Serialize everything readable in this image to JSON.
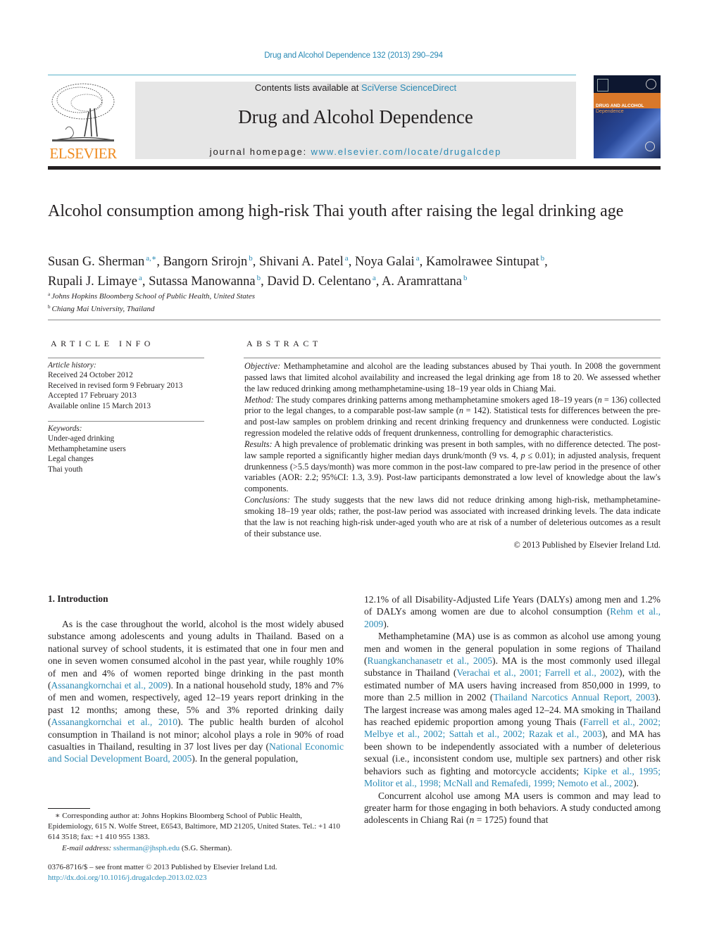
{
  "header": {
    "running_head": "Drug and Alcohol Dependence 132 (2013) 290–294",
    "contents_prefix": "Contents lists available at ",
    "contents_link": "SciVerse ScienceDirect",
    "journal_name": "Drug and Alcohol Dependence",
    "homepage_prefix": "journal homepage: ",
    "homepage_link": "www.elsevier.com/locate/drugalcdep",
    "publisher_logo_text": "ELSEVIER",
    "cover_title_line1": "DRUG AND ALCOHOL",
    "cover_title_line2": "Dependence"
  },
  "colors": {
    "link": "#2a8ab5",
    "elsevier_orange": "#ef8a1e",
    "banner_gray": "#e6e6e6",
    "cover_orange": "#d9782a",
    "cover_blue": "#2a4a9a"
  },
  "article": {
    "title": "Alcohol consumption among high-risk Thai youth after raising the legal drinking age",
    "authors": [
      {
        "name": "Susan G. Sherman",
        "aff": "a,∗",
        "sep": ", "
      },
      {
        "name": "Bangorn Srirojn",
        "aff": "b",
        "sep": ", "
      },
      {
        "name": "Shivani A. Patel",
        "aff": "a",
        "sep": ", "
      },
      {
        "name": "Noya Galai",
        "aff": "a",
        "sep": ", "
      },
      {
        "name": "Kamolrawee Sintupat",
        "aff": "b",
        "sep": ","
      },
      {
        "name": "Rupali J. Limaye",
        "aff": "a",
        "sep": ", "
      },
      {
        "name": "Sutassa Manowanna",
        "aff": "b",
        "sep": ", "
      },
      {
        "name": "David D. Celentano",
        "aff": "a",
        "sep": ", "
      },
      {
        "name": "A. Aramrattana",
        "aff": "b",
        "sep": ""
      }
    ],
    "affiliations": [
      {
        "label": "a",
        "text": "Johns Hopkins Bloomberg School of Public Health, United States"
      },
      {
        "label": "b",
        "text": "Chiang Mai University, Thailand"
      }
    ]
  },
  "article_info": {
    "heading": "ARTICLE INFO",
    "history_label": "Article history:",
    "history": [
      "Received 24 October 2012",
      "Received in revised form 9 February 2013",
      "Accepted 17 February 2013",
      "Available online 15 March 2013"
    ],
    "keywords_label": "Keywords:",
    "keywords": [
      "Under-aged drinking",
      "Methamphetamine users",
      "Legal changes",
      "Thai youth"
    ]
  },
  "abstract": {
    "heading": "ABSTRACT",
    "objective_label": "Objective:",
    "objective": " Methamphetamine and alcohol are the leading substances abused by Thai youth. In 2008 the government passed laws that limited alcohol availability and increased the legal drinking age from 18 to 20. We assessed whether the law reduced drinking among methamphetamine-using 18–19 year olds in Chiang Mai.",
    "method_label": "Method:",
    "method_1": " The study compares drinking patterns among methamphetamine smokers aged 18–19 years (",
    "method_n1": "n",
    "method_2": " = 136) collected prior to the legal changes, to a comparable post-law sample (",
    "method_n2": "n",
    "method_3": " = 142). Statistical tests for differences between the pre- and post-law samples on problem drinking and recent drinking frequency and drunkenness were conducted. Logistic regression modeled the relative odds of frequent drunkenness, controlling for demographic characteristics.",
    "results_label": "Results:",
    "results_1": " A high prevalence of problematic drinking was present in both samples, with no difference detected. The post-law sample reported a significantly higher median days drunk/month (9 vs. 4, ",
    "results_p": "p",
    "results_2": " ≤ 0.01); in adjusted analysis, frequent drunkenness (>5.5 days/month) was more common in the post-law compared to pre-law period in the presence of other variables (AOR: 2.2; 95%CI: 1.3, 3.9). Post-law participants demonstrated a low level of knowledge about the law's components.",
    "conclusions_label": "Conclusions:",
    "conclusions": " The study suggests that the new laws did not reduce drinking among high-risk, methamphetamine-smoking 18–19 year olds; rather, the post-law period was associated with increased drinking levels. The data indicate that the law is not reaching high-risk under-aged youth who are at risk of a number of deleterious outcomes as a result of their substance use.",
    "copyright": "© 2013 Published by Elsevier Ireland Ltd."
  },
  "intro": {
    "heading": "1.  Introduction",
    "p1_a": "As is the case throughout the world, alcohol is the most widely abused substance among adolescents and young adults in Thailand. Based on a national survey of school students, it is estimated that one in four men and one in seven women consumed alcohol in the past year, while roughly 10% of men and 4% of women reported binge drinking in the past month (",
    "p1_ref1": "Assanangkornchai et al., 2009",
    "p1_b": "). In a national household study, 18% and 7% of men and women, respectively, aged 12–19 years report drinking in the past 12 months; among these, 5% and 3% reported drinking daily (",
    "p1_ref2": "Assanangkornchai et al., 2010",
    "p1_c": "). The public health burden of alcohol consumption in Thailand is not minor; alcohol plays a role in 90% of road casualties in Thailand, resulting in 37 lost lives per day (",
    "p1_ref3": "National Economic and Social Development Board, 2005",
    "p1_d": "). In the general population,",
    "p1_cont": "12.1% of all Disability-Adjusted Life Years (DALYs) among men and 1.2% of DALYs among women are due to alcohol consumption (",
    "p1_ref4": "Rehm et al., 2009",
    "p1_end": ").",
    "p2_a": "Methamphetamine (MA) use is as common as alcohol use among young men and women in the general population in some regions of Thailand (",
    "p2_ref1": "Ruangkanchanasetr et al., 2005",
    "p2_b": "). MA is the most commonly used illegal substance in Thailand (",
    "p2_ref2": "Verachai et al., 2001; Farrell et al., 2002",
    "p2_c": "), with the estimated number of MA users having increased from 850,000 in 1999, to more than 2.5 million in 2002 (",
    "p2_ref3": "Thailand Narcotics Annual Report, 2003",
    "p2_d": "). The largest increase was among males aged 12–24. MA smoking in Thailand has reached epidemic proportion among young Thais (",
    "p2_ref4": "Farrell et al., 2002; Melbye et al., 2002; Sattah et al., 2002; Razak et al., 2003",
    "p2_e": "), and MA has been shown to be independently associated with a number of deleterious sexual (i.e., inconsistent condom use, multiple sex partners) and other risk behaviors such as fighting and motorcycle accidents; ",
    "p2_ref5": "Kipke et al., 1995; Molitor et al., 1998; McNall and Remafedi, 1999; Nemoto et al., 2002",
    "p2_f": ").",
    "p3_a": "Concurrent alcohol use among MA users is common and may lead to greater harm for those engaging in both behaviors. A study conducted among adolescents in Chiang Rai (",
    "p3_n": "n",
    "p3_b": " = 1725) found that"
  },
  "footnote": {
    "corresponding": "∗ Corresponding author at: Johns Hopkins Bloomberg School of Public Health, Epidemiology, 615 N. Wolfe Street, E6543, Baltimore, MD 21205, United States. Tel.: +1 410 614 3518; fax: +1 410 955 1383.",
    "email_label": "E-mail address:",
    "email": "ssherman@jhsph.edu",
    "email_suffix": " (S.G. Sherman).",
    "front_matter": "0376-8716/$ – see front matter © 2013 Published by Elsevier Ireland Ltd.",
    "doi": "http://dx.doi.org/10.1016/j.drugalcdep.2013.02.023"
  }
}
